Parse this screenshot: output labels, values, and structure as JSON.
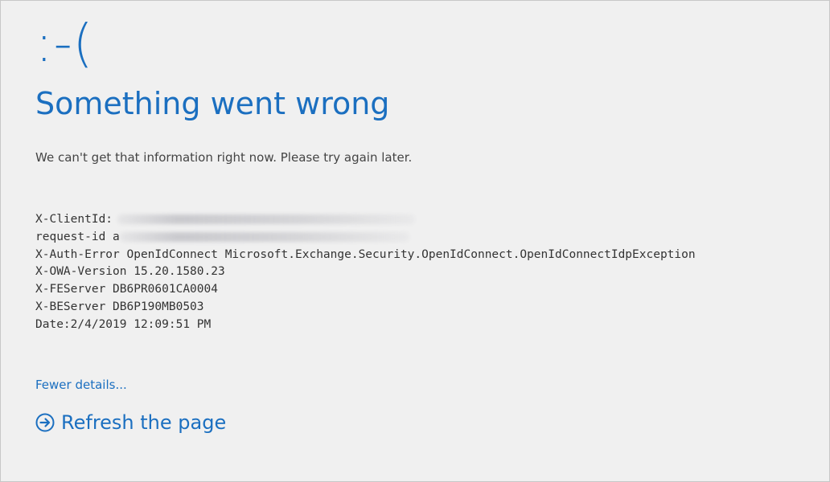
{
  "error": {
    "face": ":-(",
    "title": "Something went wrong",
    "message": "We can't get that information right now. Please try again later."
  },
  "details": {
    "client_id_label": "X-ClientId:",
    "request_id_label": "request-id a",
    "auth_error": "X-Auth-Error OpenIdConnect Microsoft.Exchange.Security.OpenIdConnect.OpenIdConnectIdpException",
    "owa_version": "X-OWA-Version 15.20.1580.23",
    "fe_server": "X-FEServer DB6PR0601CA0004",
    "be_server": "X-BEServer DB6P190MB0503",
    "date": "Date:2/4/2019 12:09:51 PM"
  },
  "links": {
    "fewer_details": "Fewer details...",
    "refresh": "Refresh the page"
  },
  "colors": {
    "accent": "#1b6fc0",
    "background": "#f0f0f0",
    "text": "#444444"
  },
  "icons": {
    "refresh": "circle-arrow-right-icon"
  }
}
